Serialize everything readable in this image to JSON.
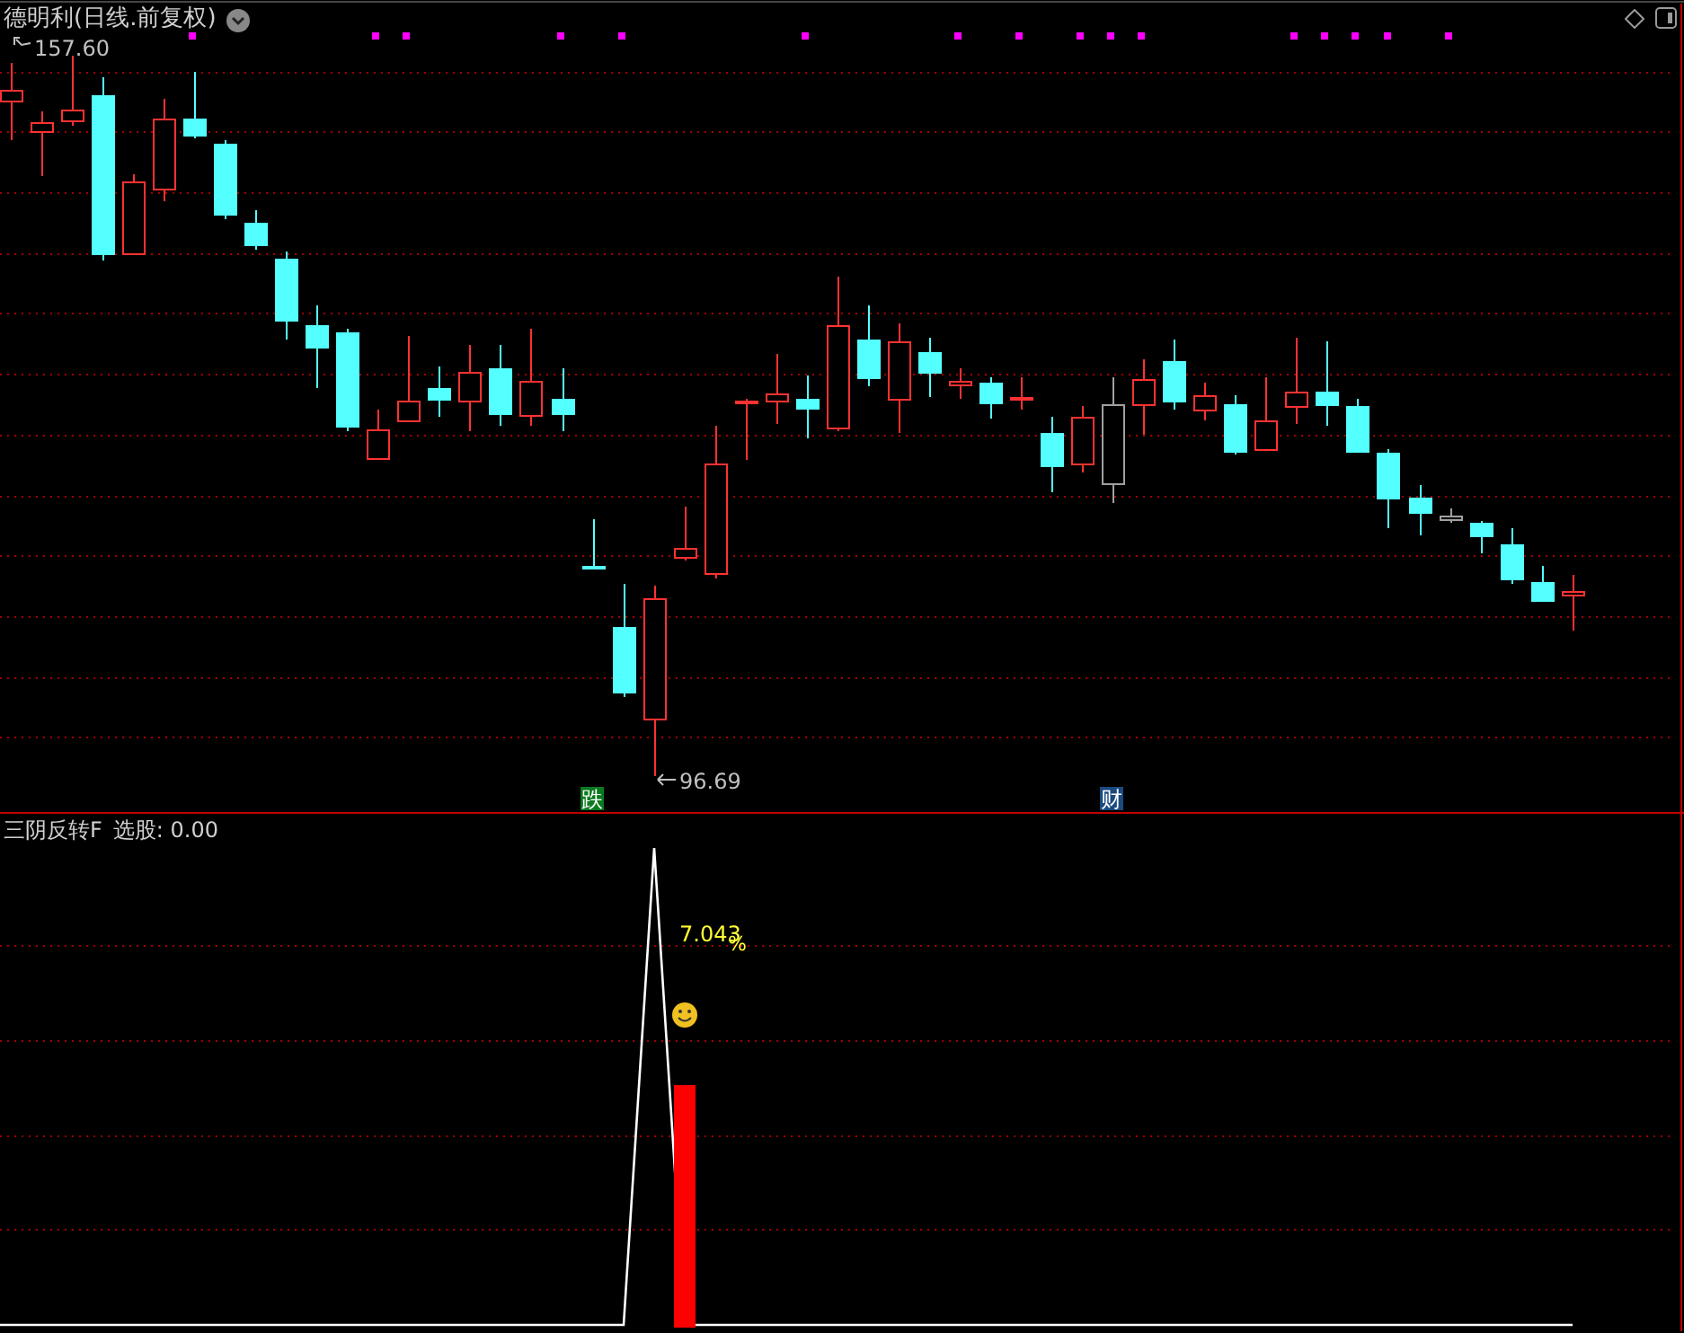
{
  "main_panel": {
    "title": "德明利(日线.前复权)",
    "high_label": "157.60",
    "low_label": "96.69",
    "signal_markers": [
      {
        "text": "跌",
        "color": "#0a7a1e"
      },
      {
        "text": "财",
        "color": "#1a4a80"
      }
    ]
  },
  "indicator_panel": {
    "name": "三阴反转F",
    "reading": "选股: 0.00",
    "annotation": "7.043",
    "unit": "%"
  }
}
